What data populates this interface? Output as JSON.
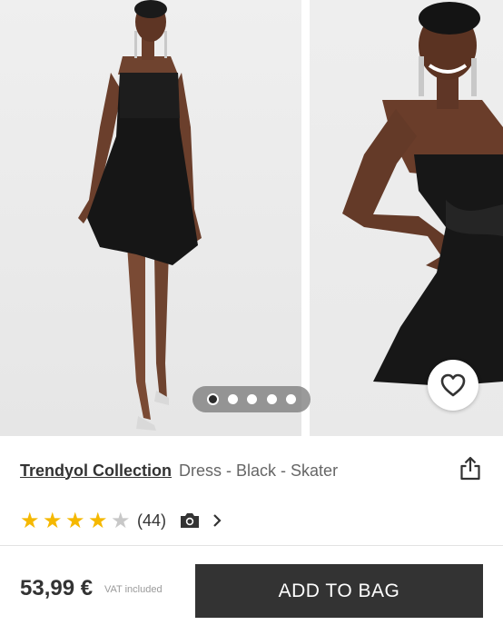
{
  "gallery": {
    "image_count": 5,
    "active_index": 0
  },
  "product": {
    "brand": "Trendyol Collection",
    "name": "Dress - Black - Skater",
    "rating": 4.5,
    "review_count": "(44)"
  },
  "pricing": {
    "price": "53,99 €",
    "vat_note": "VAT included"
  },
  "actions": {
    "add_to_bag_label": "ADD TO BAG"
  },
  "icons": {
    "favorite": "heart-icon",
    "share": "share-icon",
    "photos": "camera-icon",
    "more": "chevron-right-icon"
  },
  "colors": {
    "star": "#f5b800",
    "button_bg": "#333333",
    "button_text": "#ffffff"
  }
}
